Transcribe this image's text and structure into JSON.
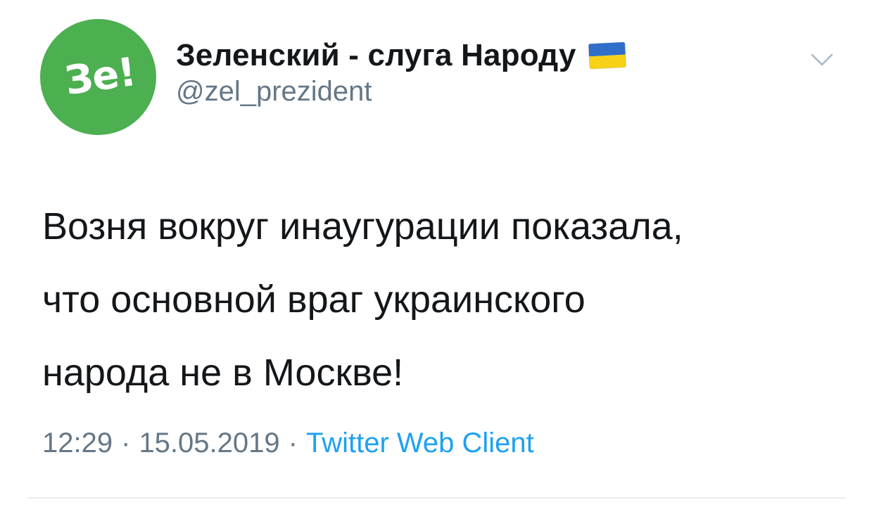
{
  "tweet": {
    "avatar": {
      "text": "Зе!",
      "color": "#4caf50"
    },
    "author": {
      "display_name": "Зеленский - слуга Народу",
      "flag_icon": "ukraine-flag-emoji",
      "handle": "@zel_prezident"
    },
    "menu_icon": "chevron-down-icon",
    "text_lines": [
      "Возня вокруг инаугурации показала,",
      "что основной враг украинского",
      "народа не в Москве!"
    ],
    "meta": {
      "time": "12:29",
      "separator": "·",
      "date": "15.05.2019",
      "source": "Twitter Web Client"
    },
    "colors": {
      "text": "#14171a",
      "secondary": "#657786",
      "link": "#1da1f2",
      "divider": "#e6ecf0"
    }
  }
}
